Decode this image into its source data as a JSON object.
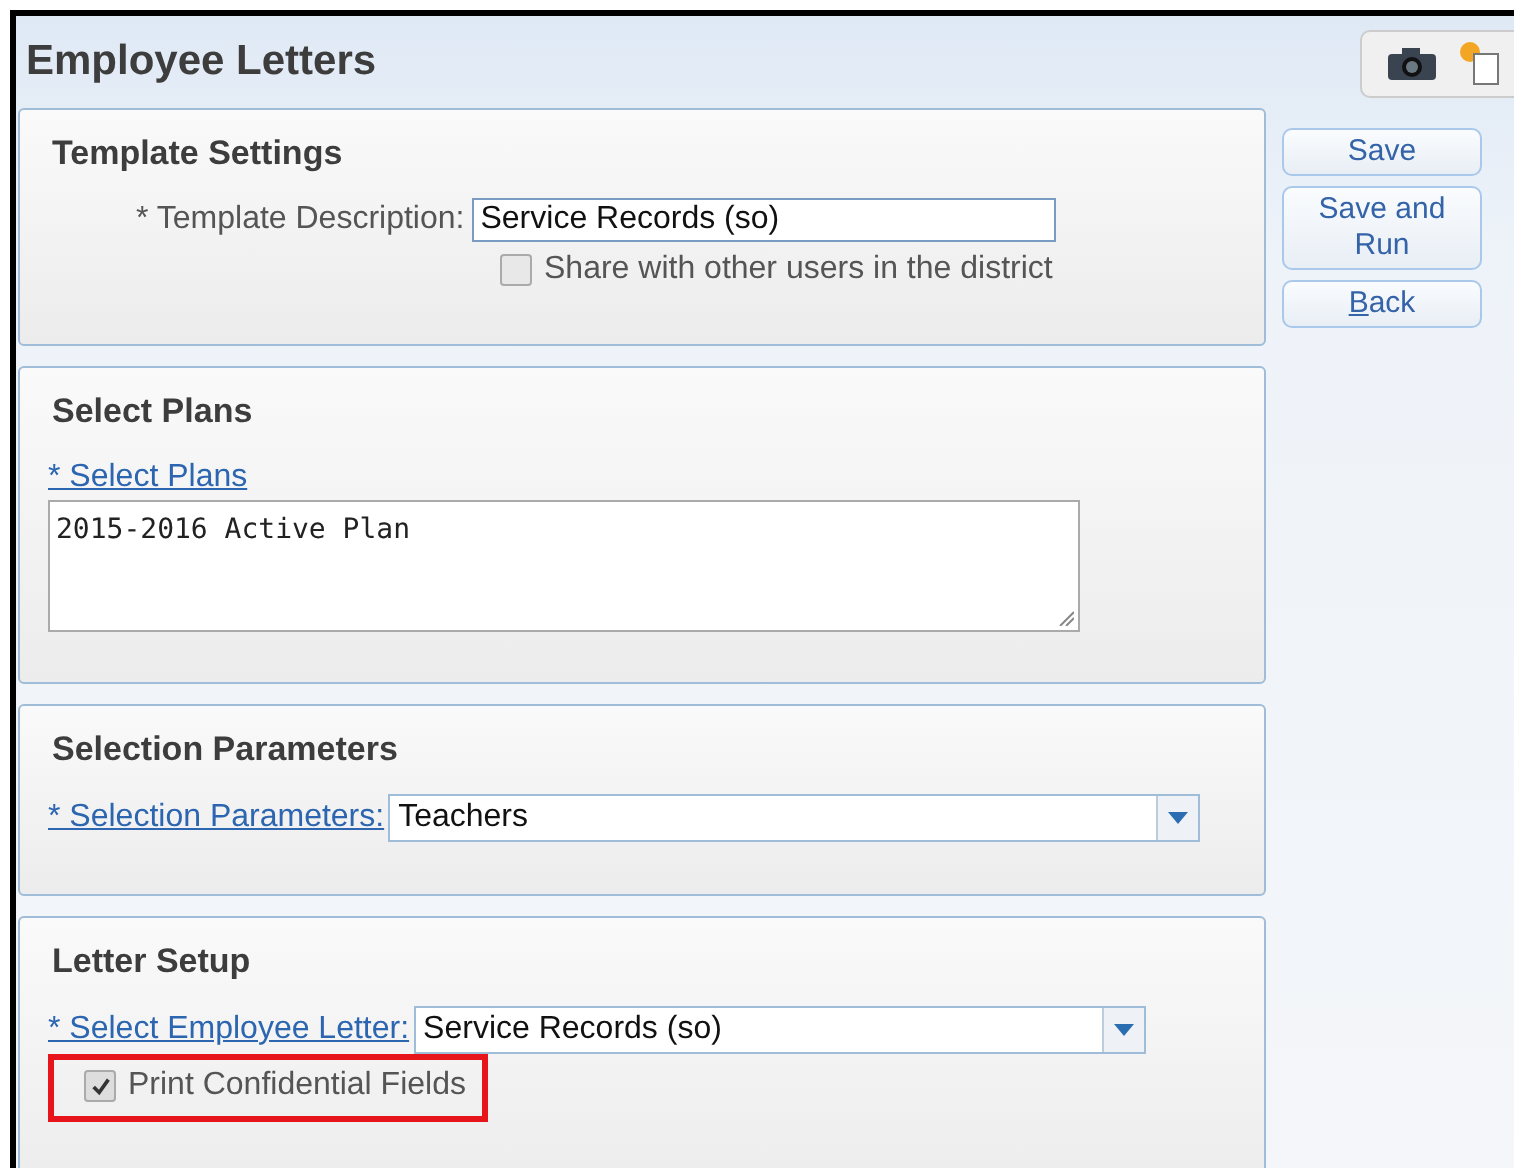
{
  "title": "Employee Letters",
  "template_settings": {
    "heading": "Template Settings",
    "description_label": "* Template Description:",
    "description_value": "Service Records (so)",
    "share": {
      "label": "Share with other users in the district",
      "checked": false
    }
  },
  "select_plans": {
    "heading": "Select Plans",
    "link": "* Select Plans",
    "plans_text": "2015-2016 Active Plan"
  },
  "selection_parameters": {
    "heading": "Selection Parameters",
    "link": "* Selection Parameters:",
    "value": "Teachers"
  },
  "letter_setup": {
    "heading": "Letter Setup",
    "link": "* Select Employee Letter:",
    "value": "Service Records (so)",
    "print_confidential": {
      "label": "Print Confidential Fields",
      "checked": true,
      "highlighted": true
    }
  },
  "buttons": [
    {
      "label": "Save"
    },
    {
      "label": "Save and Run"
    },
    {
      "label": "Back"
    }
  ]
}
